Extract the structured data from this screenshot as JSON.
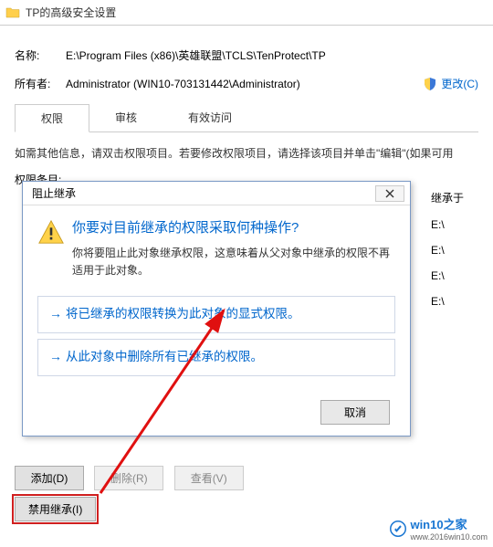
{
  "window": {
    "title": "TP的高级安全设置"
  },
  "info": {
    "name_label": "名称:",
    "name_value": "E:\\Program Files (x86)\\英雄联盟\\TCLS\\TenProtect\\TP",
    "owner_label": "所有者:",
    "owner_value": "Administrator (WIN10-703131442\\Administrator)",
    "change_link": "更改(C)"
  },
  "tabs": {
    "perm": "权限",
    "audit": "审核",
    "effective": "有效访问"
  },
  "instructions": "如需其他信息，请双击权限项目。若要修改权限项目，请选择该项目并单击\"编辑\"(如果可用",
  "entries_label": "权限条目:",
  "inherit": {
    "header": "继承于",
    "items": [
      "E:\\",
      "E:\\",
      "E:\\",
      "E:\\"
    ]
  },
  "buttons": {
    "add": "添加(D)",
    "remove": "删除(R)",
    "view": "查看(V)",
    "disable_inherit": "禁用继承(I)"
  },
  "dialog": {
    "title": "阻止继承",
    "main": "你要对目前继承的权限采取何种操作?",
    "sub": "你将要阻止此对象继承权限，这意味着从父对象中继承的权限不再适用于此对象。",
    "opt1": "将已继承的权限转换为此对象的显式权限。",
    "opt2": "从此对象中删除所有已继承的权限。",
    "cancel": "取消"
  },
  "watermark": {
    "brand": "win10之家",
    "url": "www.2016win10.com"
  }
}
